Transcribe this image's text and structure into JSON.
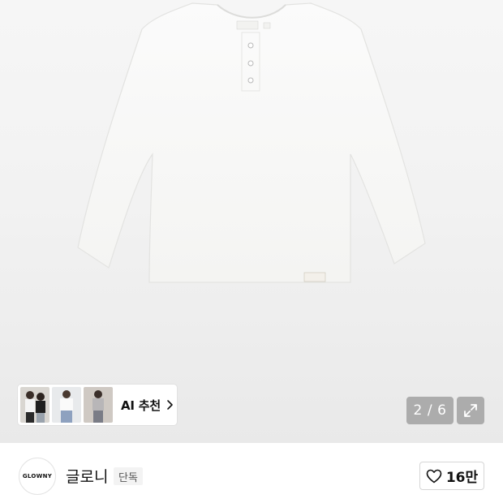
{
  "gallery": {
    "product_brand_tag": "GLOWNY",
    "ai_recommend": {
      "label": "AI 추천",
      "thumbnails": [
        "outfit-thumbnail-1",
        "outfit-thumbnail-2",
        "outfit-thumbnail-3"
      ]
    },
    "counter": {
      "current": "2",
      "separator": "/",
      "total": "6"
    },
    "expand_icon": "expand-icon"
  },
  "brand": {
    "logo_text": "GLOWNY",
    "name": "글로니",
    "badge": "단독",
    "likes": "16만",
    "like_icon": "heart-icon"
  },
  "colors": {
    "background": "#f2f2f2",
    "overlay_button": "#8a8a8a",
    "text": "#111111"
  }
}
